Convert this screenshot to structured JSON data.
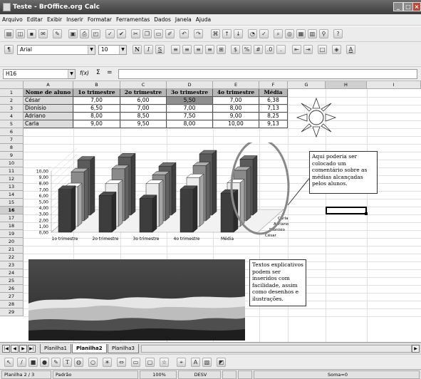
{
  "window": {
    "title": "Teste - BrOffice.org Calc",
    "controls": [
      "_",
      "□",
      "×"
    ]
  },
  "menu": [
    "Arquivo",
    "Editar",
    "Exibir",
    "Inserir",
    "Formatar",
    "Ferramentas",
    "Dados",
    "Janela",
    "Ajuda"
  ],
  "format_bar": {
    "font_name": "Arial",
    "font_size": "10",
    "bold": "N",
    "italic": "I",
    "underline": "S"
  },
  "formula_bar": {
    "cell_ref": "H16",
    "fx": "f(x)",
    "sigma": "Σ",
    "equals": "="
  },
  "columns": [
    "A",
    "B",
    "C",
    "D",
    "E",
    "F",
    "G",
    "H",
    "I"
  ],
  "rows": [
    "1",
    "2",
    "3",
    "4",
    "5",
    "6",
    "7",
    "8",
    "9",
    "10",
    "11",
    "12",
    "13",
    "14",
    "15",
    "16",
    "17",
    "18",
    "19",
    "20",
    "21",
    "22",
    "23",
    "24",
    "25",
    "26",
    "27",
    "28",
    "29"
  ],
  "table": {
    "headers": [
      "Nome de aluno",
      "1o trimestre",
      "2o trimestre",
      "3o trimestre",
      "4o trimestre",
      "Média"
    ],
    "rows": [
      [
        "César",
        "7,00",
        "6,00",
        "5,50",
        "7,00",
        "6,38"
      ],
      [
        "Dionísio",
        "6,50",
        "7,00",
        "7,00",
        "8,00",
        "7,13"
      ],
      [
        "Adriano",
        "8,00",
        "8,50",
        "7,50",
        "9,00",
        "8,25"
      ],
      [
        "Carla",
        "9,00",
        "9,50",
        "8,00",
        "10,00",
        "9,13"
      ]
    ]
  },
  "chart_data": {
    "type": "bar",
    "categories": [
      "1o trimestre",
      "2o trimestre",
      "3o trimestre",
      "4o trimestre",
      "Média"
    ],
    "series": [
      {
        "name": "César",
        "values": [
          7.0,
          6.0,
          5.5,
          7.0,
          6.38
        ]
      },
      {
        "name": "Dionísio",
        "values": [
          6.5,
          7.0,
          7.0,
          8.0,
          7.13
        ]
      },
      {
        "name": "Adriano",
        "values": [
          8.0,
          8.5,
          7.5,
          9.0,
          8.25
        ]
      },
      {
        "name": "Carla",
        "values": [
          9.0,
          9.5,
          8.0,
          10.0,
          9.13
        ]
      }
    ],
    "yticks": [
      "10,00",
      "9,00",
      "8,00",
      "7,00",
      "6,00",
      "5,00",
      "4,00",
      "3,00",
      "2,00",
      "1,00",
      "0,00"
    ],
    "ylim": [
      0,
      10
    ],
    "series_colors": [
      "#3d3d3d",
      "#ececec",
      "#8a8a8a",
      "#5a5a5a"
    ]
  },
  "comments": {
    "chart_note": "Aqui poderia ser colocado um comentário sobre as médias alcançadas pelos alunos.",
    "image_note": "Textos explicativos podem ser inseridos com facilidade, assim como desenhos e ilustrações."
  },
  "sheet_tabs": [
    "Planilha1",
    "Planilha2",
    "Planilha3"
  ],
  "active_tab": "Planilha2",
  "status": {
    "sheet": "Planilha 2 / 3",
    "style": "Padrão",
    "zoom": "100%",
    "mode": "DESV",
    "sum": "Soma=0"
  }
}
